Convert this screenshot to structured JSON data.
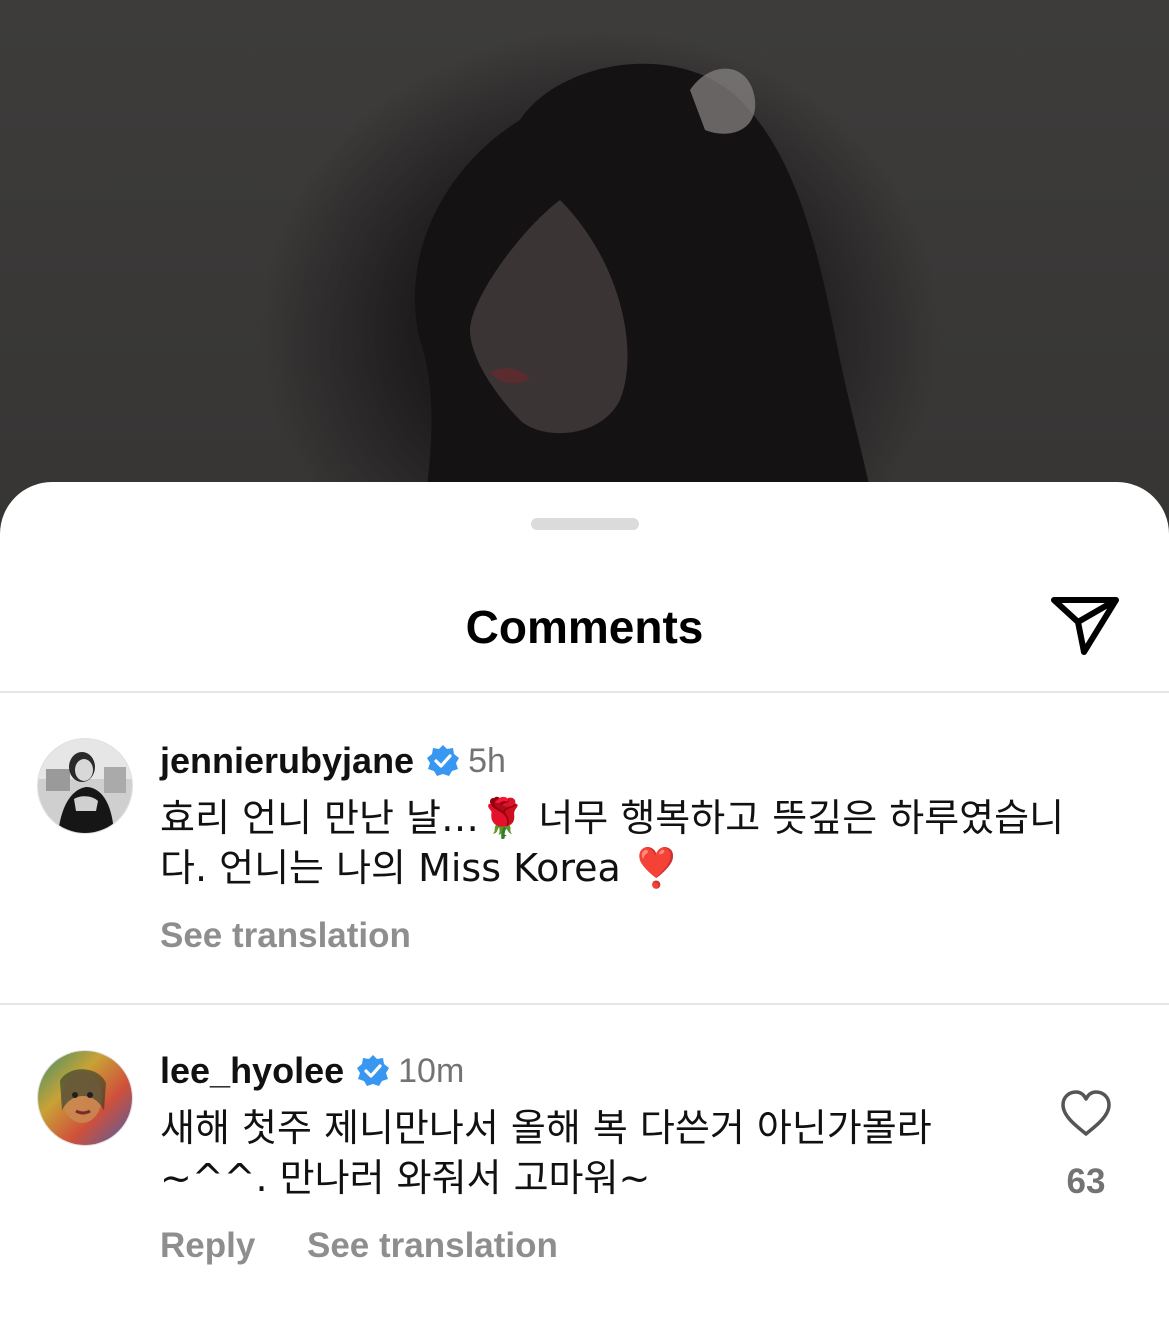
{
  "sheet": {
    "title": "Comments"
  },
  "comments": [
    {
      "username": "jennierubyjane",
      "time": "5h",
      "line1": "효리 언니 만난 날…🌹 너무 행복하고 뜻깊은 하루였습니",
      "line2": "다. 언니는 나의 Miss Korea  ❣️",
      "see_translation": "See translation"
    },
    {
      "username": "lee_hyolee",
      "time": "10m",
      "line1": "새해 첫주 제니만나서 올해 복 다쓴거 아닌가몰라",
      "line2": "~^^. 만나러 와줘서 고마워~",
      "reply": "Reply",
      "see_translation": "See translation",
      "like_count": "63"
    }
  ],
  "colors": {
    "verified_badge": "#3897f0",
    "secondary_text": "#8e8e8e"
  },
  "icons": {
    "send": "paper-plane-icon",
    "verified": "verified-badge-icon",
    "like": "heart-outline-icon"
  }
}
